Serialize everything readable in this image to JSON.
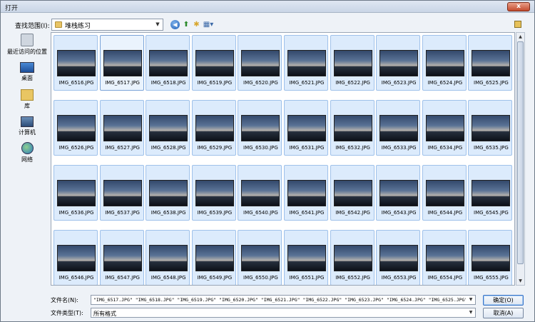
{
  "window": {
    "title": "打开",
    "close_label": "x"
  },
  "toolbar": {
    "lookin_label": "查找范围(I):",
    "lookin_value": "堆栈练习"
  },
  "places": [
    {
      "label": "最近访问的位置",
      "icon": "recent-places-icon"
    },
    {
      "label": "桌面",
      "icon": "desktop-icon"
    },
    {
      "label": "库",
      "icon": "library-icon"
    },
    {
      "label": "计算机",
      "icon": "computer-icon"
    },
    {
      "label": "网络",
      "icon": "network-icon"
    }
  ],
  "files": [
    "IMG_6516.JPG",
    "IMG_6517.JPG",
    "IMG_6518.JPG",
    "IMG_6519.JPG",
    "IMG_6520.JPG",
    "IMG_6521.JPG",
    "IMG_6522.JPG",
    "IMG_6523.JPG",
    "IMG_6524.JPG",
    "IMG_6525.JPG",
    "IMG_6526.JPG",
    "IMG_6527.JPG",
    "IMG_6528.JPG",
    "IMG_6529.JPG",
    "IMG_6530.JPG",
    "IMG_6531.JPG",
    "IMG_6532.JPG",
    "IMG_6533.JPG",
    "IMG_6534.JPG",
    "IMG_6535.JPG",
    "IMG_6536.JPG",
    "IMG_6537.JPG",
    "IMG_6538.JPG",
    "IMG_6539.JPG",
    "IMG_6540.JPG",
    "IMG_6541.JPG",
    "IMG_6542.JPG",
    "IMG_6543.JPG",
    "IMG_6544.JPG",
    "IMG_6545.JPG",
    "IMG_6546.JPG",
    "IMG_6547.JPG",
    "IMG_6548.JPG",
    "IMG_6549.JPG",
    "IMG_6550.JPG",
    "IMG_6551.JPG",
    "IMG_6552.JPG",
    "IMG_6553.JPG",
    "IMG_6554.JPG",
    "IMG_6555.JPG"
  ],
  "bottom": {
    "filename_label": "文件名(N):",
    "filename_value": "\"IMG_6517.JPG\" \"IMG_6518.JPG\" \"IMG_6519.JPG\" \"IMG_6520.JPG\" \"IMG_6521.JPG\" \"IMG_6522.JPG\" \"IMG_6523.JPG\" \"IMG_6524.JPG\" \"IMG_6525.JPG\" \"IMG_65",
    "filetype_label": "文件类型(T):",
    "filetype_value": "所有格式",
    "ok_label": "确定(O)",
    "cancel_label": "取消(A)"
  }
}
